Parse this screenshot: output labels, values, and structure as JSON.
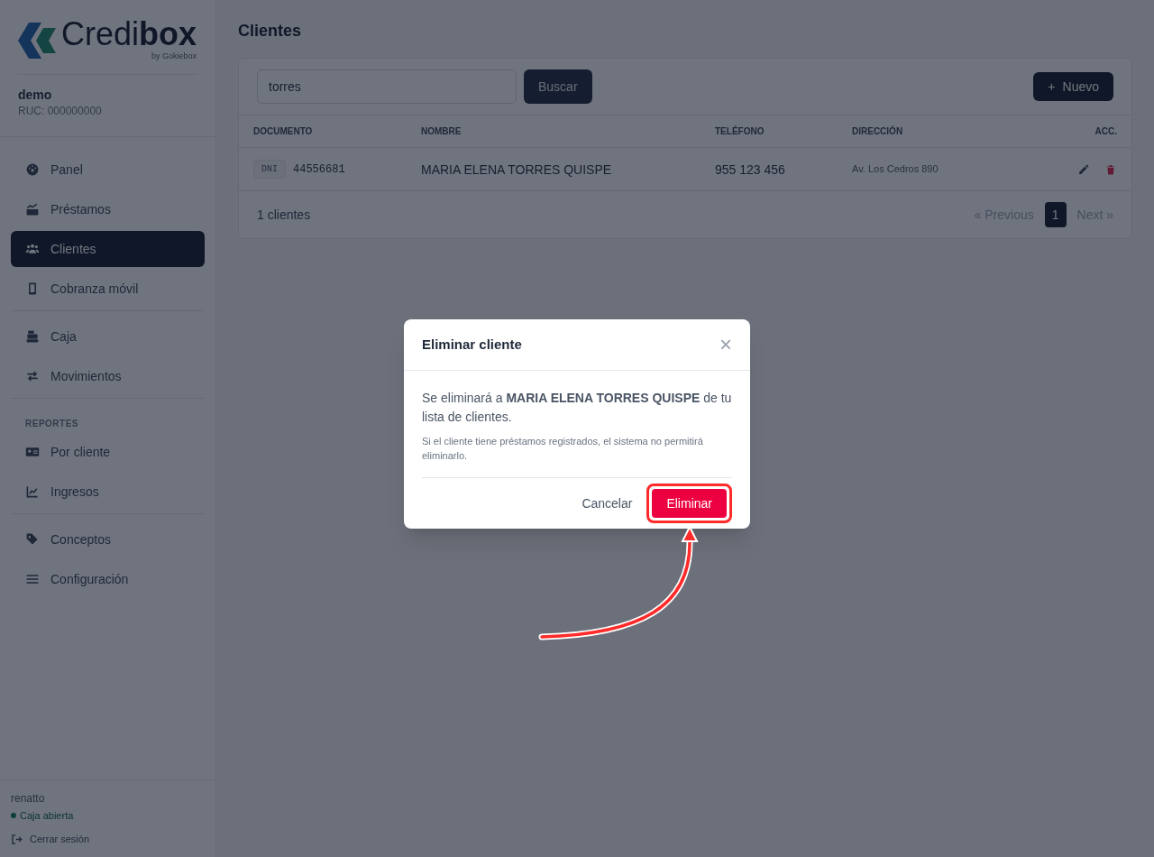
{
  "brand": {
    "logo": "Credi**box**",
    "byline": "by Gokiebox"
  },
  "company": {
    "name": "demo",
    "ruc": "RUC: 000000000"
  },
  "sidebar": {
    "groups": [
      {
        "items": [
          {
            "label": "Panel",
            "selected": false
          },
          {
            "label": "Préstamos",
            "selected": false
          },
          {
            "label": "Clientes",
            "selected": true
          },
          {
            "label": "Cobranza móvil",
            "selected": false
          }
        ]
      },
      {
        "items": [
          {
            "label": "Caja",
            "selected": false
          },
          {
            "label": "Movimientos",
            "selected": false
          }
        ]
      },
      {
        "heading": "REPORTES",
        "items": [
          {
            "label": "Por cliente",
            "selected": false
          },
          {
            "label": "Ingresos",
            "selected": false
          }
        ]
      },
      {
        "items": [
          {
            "label": "Conceptos",
            "selected": false
          },
          {
            "label": "Configuración",
            "selected": false
          }
        ]
      }
    ]
  },
  "user": {
    "name": "renatto",
    "status": "Caja abierta",
    "logout": "Cerrar sesión"
  },
  "page_title": "Clientes",
  "search": {
    "value": "torres",
    "button": "Buscar"
  },
  "new_button": {
    "icon": "+",
    "label": "Nuevo"
  },
  "table": {
    "columns": [
      "DOCUMENTO",
      "NOMBRE",
      "TELÉFONO",
      "DIRECCIÓN",
      "ACC."
    ],
    "rows": [
      {
        "doc_type": "DNI",
        "doc_number": "44556681",
        "name": "MARIA ELENA TORRES QUISPE",
        "phone": "955 123 456",
        "address": "Av. Los Cedros 890"
      }
    ]
  },
  "footer": {
    "count": "1 clientes",
    "previous": "« Previous",
    "pages": [
      {
        "label": "1",
        "selected": true
      }
    ],
    "next": "Next »"
  },
  "dialog": {
    "title": "Eliminar cliente",
    "close": "×",
    "message": "Se eliminará a **MARIA ELENA TORRES QUISPE** de tu lista de clientes.",
    "note": "Si el cliente tiene préstamos registrados, el sistema no permitirá eliminarlo.",
    "cancel": "Cancelar",
    "confirm": "Eliminar"
  }
}
